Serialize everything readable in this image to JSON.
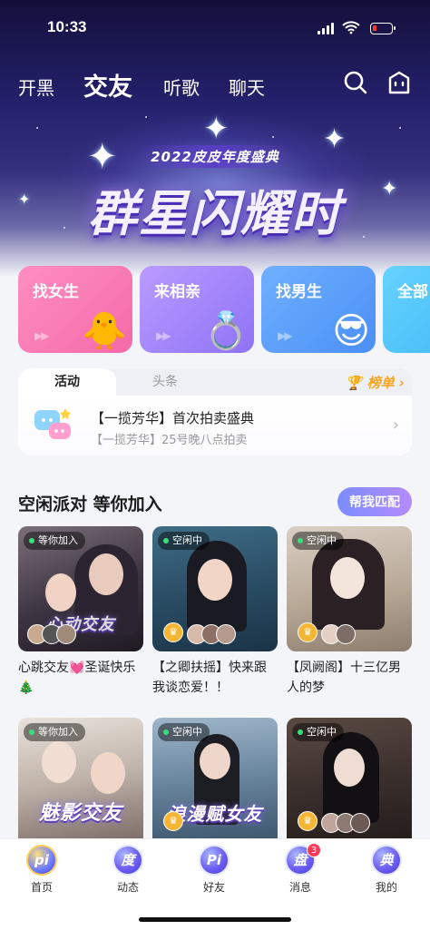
{
  "status_bar": {
    "time": "10:33"
  },
  "top_nav": {
    "tabs": [
      {
        "label": "开黑"
      },
      {
        "label": "交友"
      },
      {
        "label": "听歌"
      },
      {
        "label": "聊天"
      }
    ],
    "active_tab": "交友",
    "icons": [
      "search-icon",
      "shop-icon"
    ]
  },
  "banner": {
    "subtitle": "2022皮皮年度盛典",
    "title": "群星闪耀时"
  },
  "categories": [
    {
      "label": "找女生",
      "art": "🐥"
    },
    {
      "label": "来相亲",
      "art": "💍"
    },
    {
      "label": "找男生",
      "art": "😎"
    },
    {
      "label": "全部",
      "art": ""
    }
  ],
  "activity": {
    "tab_active": "活动",
    "tab_inactive": "头条",
    "rank_label": "🏆 榜单 ›",
    "headline": "【一揽芳华】首次拍卖盛典",
    "subline": "【一揽芳华】25号晚八点拍卖"
  },
  "party_section": {
    "title": "空闲派对 等你加入",
    "match_button": "帮我匹配"
  },
  "rooms": [
    {
      "status": "等你加入",
      "caption": "心跳交友💓圣诞快乐🎄",
      "overlay": "心动交友"
    },
    {
      "status": "空闲中",
      "caption": "【之卿扶摇】快来跟我谈恋爱！！",
      "overlay": ""
    },
    {
      "status": "空闲中",
      "caption": "【凤阙阁】十三亿男人的梦",
      "overlay": ""
    },
    {
      "status": "等你加入",
      "caption": "",
      "overlay": "魅影交友"
    },
    {
      "status": "空闲中",
      "caption": "",
      "overlay": "浪漫赋女友"
    },
    {
      "status": "空闲中",
      "caption": "",
      "overlay": ""
    }
  ],
  "bottom_nav": {
    "items": [
      {
        "label": "首页",
        "glyph": "pi"
      },
      {
        "label": "动态",
        "glyph": "度"
      },
      {
        "label": "好友",
        "glyph": "Pi"
      },
      {
        "label": "消息",
        "glyph": "盘",
        "badge": "3"
      },
      {
        "label": "我的",
        "glyph": "典"
      }
    ]
  },
  "colors": {
    "accent_gradient_start": "#7a8cff",
    "accent_gradient_end": "#b58bff",
    "rank_gold": "#f5a623",
    "status_green": "#39e07a",
    "badge_red": "#ff3b5c"
  }
}
